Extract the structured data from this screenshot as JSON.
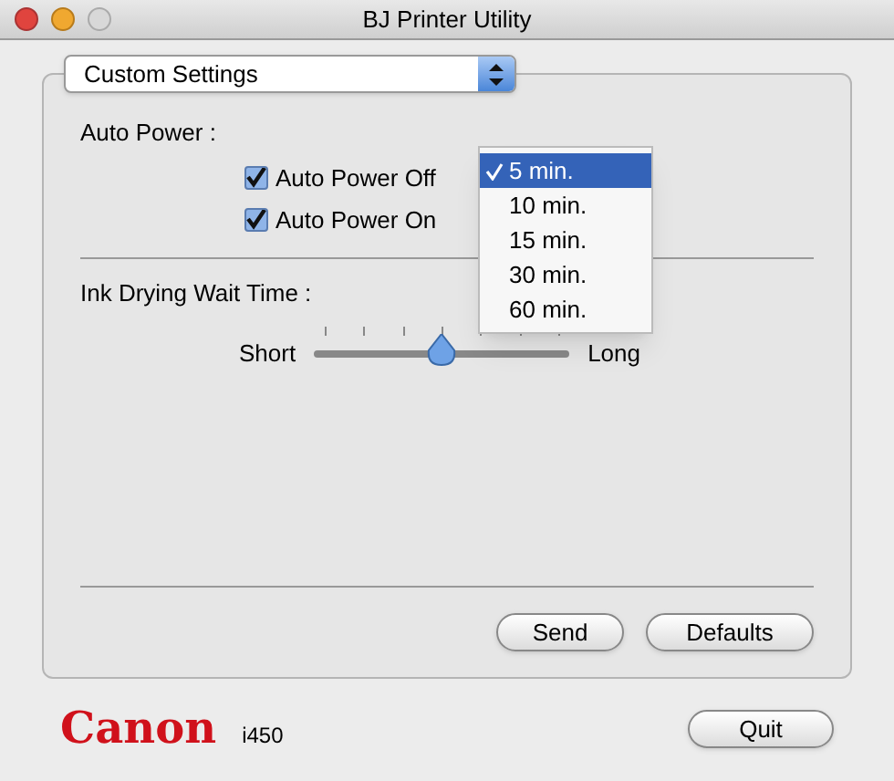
{
  "window": {
    "title": "BJ Printer Utility"
  },
  "mode_popup": {
    "value": "Custom Settings"
  },
  "auto_power": {
    "label": "Auto Power :",
    "options": [
      {
        "label": "Auto Power Off",
        "checked": true
      },
      {
        "label": "Auto Power On",
        "checked": true
      }
    ]
  },
  "time_menu": [
    {
      "label": "5 min.",
      "selected": true
    },
    {
      "label": "10 min.",
      "selected": false
    },
    {
      "label": "15 min.",
      "selected": false
    },
    {
      "label": "30 min.",
      "selected": false
    },
    {
      "label": "60 min.",
      "selected": false
    }
  ],
  "ink_drying": {
    "label": "Ink Drying Wait Time :",
    "min_label": "Short",
    "max_label": "Long",
    "level": 0.5
  },
  "buttons": [
    "Send",
    "Defaults"
  ],
  "footer": {
    "logo": "Canon",
    "model": "i450",
    "quit": "Quit"
  }
}
